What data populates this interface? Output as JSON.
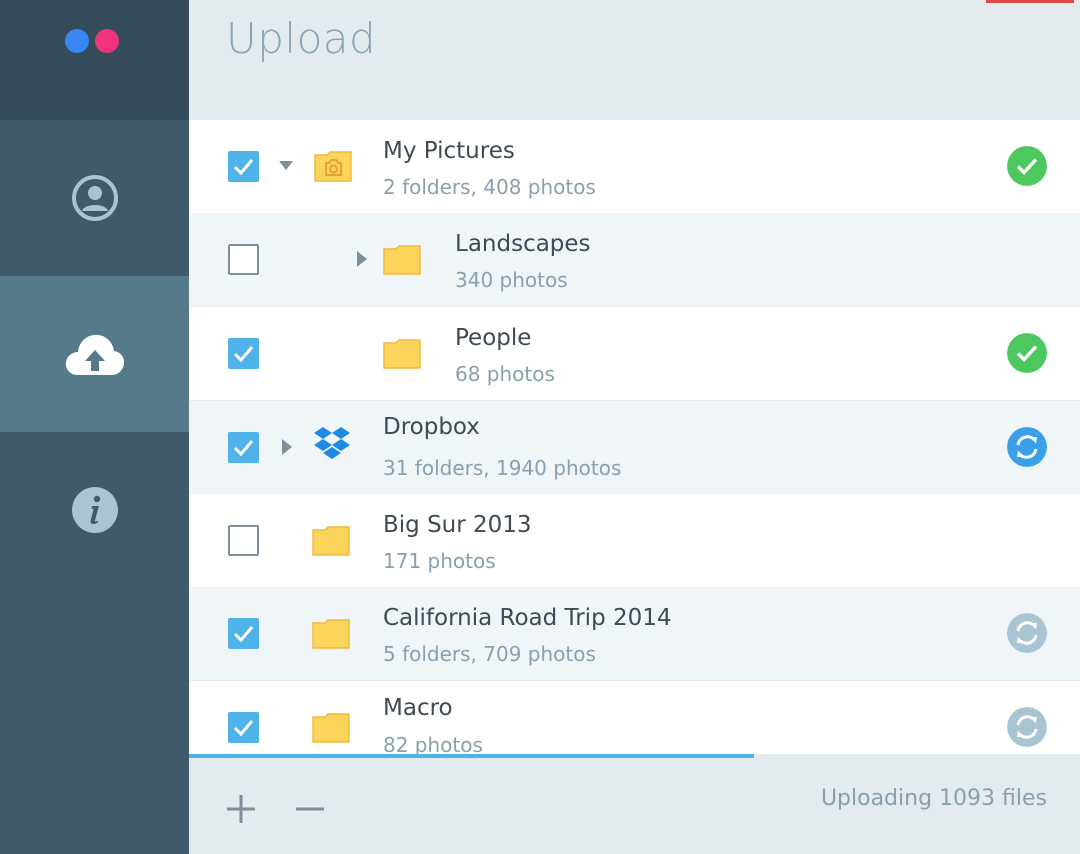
{
  "header": {
    "title": "Upload"
  },
  "sidebar": {
    "items": [
      {
        "name": "account",
        "icon": "user-icon",
        "active": false
      },
      {
        "name": "upload",
        "icon": "cloud-upload-icon",
        "active": true
      },
      {
        "name": "info",
        "icon": "info-icon",
        "active": false
      }
    ]
  },
  "folders": [
    {
      "title": "My Pictures",
      "subtitle": "2 folders, 408 photos",
      "checked": true,
      "caret": "down",
      "icon": "camera-folder-icon",
      "status": "done",
      "indent": 0
    },
    {
      "title": "Landscapes",
      "subtitle": "340 photos",
      "checked": false,
      "caret": "right",
      "icon": "folder-icon",
      "status": "none",
      "indent": 1
    },
    {
      "title": "People",
      "subtitle": "68 photos",
      "checked": true,
      "caret": "none",
      "icon": "folder-icon",
      "status": "done",
      "indent": 1
    },
    {
      "title": "Dropbox",
      "subtitle": "31 folders, 1940 photos",
      "checked": true,
      "caret": "right",
      "icon": "dropbox-icon",
      "status": "syncing",
      "indent": 0
    },
    {
      "title": "Big Sur 2013",
      "subtitle": "171 photos",
      "checked": false,
      "caret": "none",
      "icon": "folder-icon",
      "status": "none",
      "indent": 0
    },
    {
      "title": "California Road Trip 2014",
      "subtitle": "5 folders, 709 photos",
      "checked": true,
      "caret": "none",
      "icon": "folder-icon",
      "status": "pending",
      "indent": 0
    },
    {
      "title": "Macro",
      "subtitle": "82 photos",
      "checked": true,
      "caret": "none",
      "icon": "folder-icon",
      "status": "pending",
      "indent": 0
    }
  ],
  "footer": {
    "status_text": "Uploading 1093 files",
    "progress": 0.634,
    "add_label": "add-icon",
    "remove_label": "remove-icon"
  },
  "colors": {
    "accent": "#4fb3ea",
    "success": "#4cc85f",
    "syncing": "#3aa0ea",
    "pending": "#a9c4d3",
    "folder": "#fbd45c",
    "sidebar": "#3f5a6b"
  }
}
